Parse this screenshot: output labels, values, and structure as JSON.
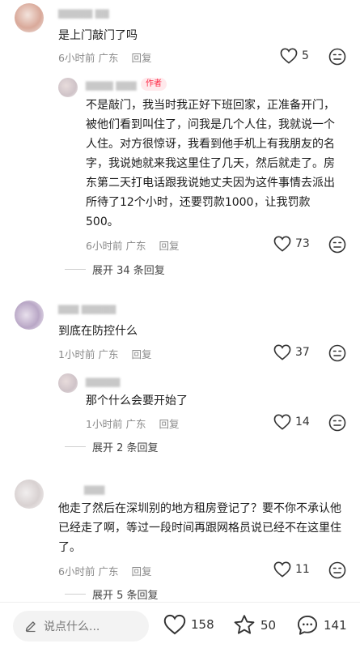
{
  "comments": [
    {
      "text": "是上门敲门了吗",
      "time": "6小时前",
      "location": "广东",
      "reply_label": "回复",
      "likes": "5"
    },
    {
      "author_tag": "作者",
      "text": "不是敲门，我当时我正好下班回家，正准备开门，被他们看到叫住了，问我是几个人住，我就说一个人住。对方很惊讶，我看到他手机上有我朋友的名字，我说她就来我这里住了几天，然后就走了。房东第二天打电话跟我说她丈夫因为这件事情去派出所待了12个小时，还要罚款1000，让我罚款500。",
      "time": "6小时前",
      "location": "广东",
      "reply_label": "回复",
      "likes": "73",
      "expand": "展开 34 条回复"
    },
    {
      "text": "到底在防控什么",
      "time": "1小时前",
      "location": "广东",
      "reply_label": "回复",
      "likes": "37"
    },
    {
      "text": "那个什么会要开始了",
      "time": "1小时前",
      "location": "广东",
      "reply_label": "回复",
      "likes": "14",
      "expand": "展开 2 条回复"
    },
    {
      "text": "他走了然后在深圳别的地方租房登记了？要不你不承认他已经走了啊，等过一段时间再跟网格员说已经不在这里住了。",
      "time": "6小时前",
      "location": "广东",
      "reply_label": "回复",
      "likes": "11",
      "expand": "展开 5 条回复"
    }
  ],
  "bottom_bar": {
    "input_placeholder": "说点什么...",
    "likes": "158",
    "favorites": "50",
    "comments": "141"
  },
  "icons": {
    "like": "heart-outline-icon",
    "dislike": "dislike-face-icon",
    "edit": "pencil-icon",
    "favorite": "star-outline-icon",
    "comment": "chat-bubble-icon"
  },
  "colors": {
    "author_tag": "#ff2442",
    "secondary_text": "#8a8a8a"
  }
}
